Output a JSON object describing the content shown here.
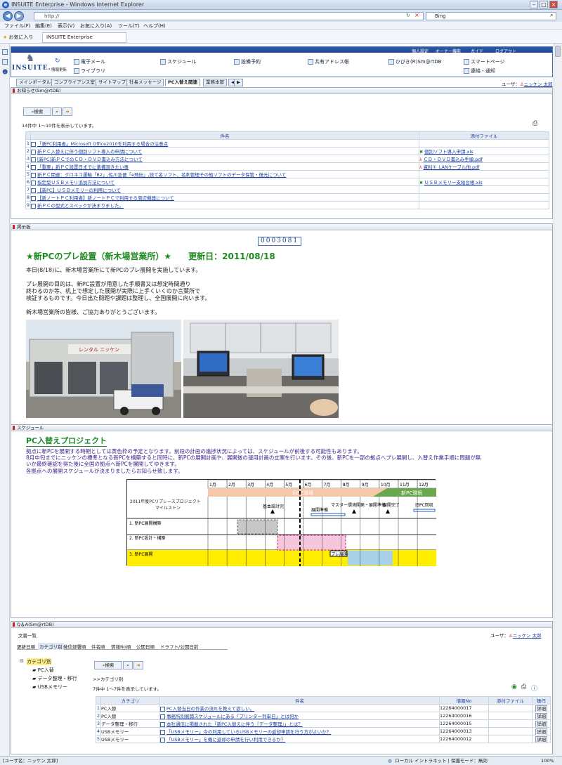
{
  "window": {
    "title": "INSUITE Enterprise - Windows Internet Explorer",
    "url": "http://",
    "search_engine": "Bing"
  },
  "menu": [
    "ファイル(F)",
    "編集(E)",
    "表示(V)",
    "お気に入り(A)",
    "ツール(T)",
    "ヘルプ(H)"
  ],
  "favorites": {
    "label": "お気に入り",
    "tab": "INSUITE Enterprise"
  },
  "header": {
    "brand": "INSUITE.",
    "refresh": "情報更新",
    "top_links": [
      "個人設定",
      "オーナー機能",
      "ガイド",
      "ログアウト"
    ],
    "links": [
      "電子メール",
      "スケジュール",
      "設備予約",
      "共有アドレス帳",
      "ひびき(R)Sm@rtDB",
      "スマートページ",
      "ライブラリ",
      "連絡・通知"
    ]
  },
  "tabs": [
    "メインポータル",
    "コンプライアンス室",
    "サイトマップ",
    "社長メッセージ",
    "PC入替え関連",
    "業務本部"
  ],
  "user_line": "ユーザ：",
  "user_name": "ニッケン 太郎",
  "news": {
    "title": "お知らせ(Sm@rtDB)",
    "search_btn": "検索",
    "count": "14件中 1〜10件を表示しています。",
    "col_subject": "件名",
    "col_file": "添付ファイル",
    "rows": [
      {
        "n": "1",
        "subject": "「新PC利用者」Microsoft Office2010を利用する場合の注意点",
        "file": ""
      },
      {
        "n": "2",
        "subject": "新ＰＣ入替えに伴う個別ソフト導入の申請について",
        "file": "個別ソフト導入申請.xls"
      },
      {
        "n": "3",
        "subject": "[新PC]新ＰＣでのＣＤ・ＤＶＤ書込み方法について",
        "file": "ＣＤ・ＤＶＤ書込み手順.pdf"
      },
      {
        "n": "4",
        "subject": "「重要」新ＰＣ設置日までに準備頂きたい事",
        "file": "資料①_LANケーブル他.pdf"
      },
      {
        "n": "5",
        "subject": "新ＰＣ関連：クロネコ運輸「B2」,佐川急便「e飛伝」,読て名ソフト、名刺管理その他ソフトのデータ保管・復元について",
        "file": ""
      },
      {
        "n": "6",
        "subject": "指定型ＵＳＢメモリ追加方法について",
        "file": "ＵＳＢメモリー支給台帳.xls"
      },
      {
        "n": "7",
        "subject": "【新PC】ＵＳＢメモリーの利用について",
        "file": ""
      },
      {
        "n": "8",
        "subject": "【新ノートＰＣ利用者】新ノートＰＣで利用する周辺機器について",
        "file": ""
      },
      {
        "n": "9",
        "subject": "新ＰＣの型式とスペックが決まりました。",
        "file": ""
      }
    ]
  },
  "announce": {
    "title": "掲示板",
    "counter": "0003081",
    "heading": "★新PCのプレ設置（新木場営業所）★　　更新日：2011/08/18",
    "lines": [
      "本日(8/18)に、新木場営業所にて新PCのプレ展開を実施しています。",
      "プレ展開の目的は、新PC設置が用意した手順書又は想定時間通り",
      "終わるのか等、机上で想定した展開が実際に上手くいくのか言葉所で",
      "検証するものです。今日出た問題や課題は整理し、全国展開に向います。",
      "新木場営業所の皆様、ご協力ありがとうございます。"
    ]
  },
  "schedule": {
    "panel_title": "スケジュール",
    "title": "PC入替えプロジェクト",
    "lines": [
      "拠点に新PCを展開する時期としては黄色枠の予定となります。前段の計画の進捗状況によっては、スケジュールが前後する可能性もあります。",
      "8月中旬までにニッケンの標準となる新PCを構築すると同時に、新PCの展開計画や、展開後の運用計画の立案を行います。その後、新PCを一部の拠点へプレ展開し、入替え作業手順に問題が無",
      "いか最終確認を得た後に全国の拠点へ新PCを展開してゆきます。",
      "各拠点への展開スケジュールが決まりましたらお知らせ致します。"
    ],
    "gantt": {
      "months": [
        "1月",
        "2月",
        "3月",
        "4月",
        "5月",
        "6月",
        "7月",
        "8月",
        "9月",
        "10月",
        "11月",
        "12月"
      ],
      "header_left": "2011年度PCリプレースプロジェクト\nマイルストン",
      "phase_old": "旧PC環境",
      "phase_new": "新PC環境",
      "milestones": [
        "基本設計完",
        "展開準備",
        "マスター環境開発・展開準備",
        "展開完了",
        "旧PC回収"
      ],
      "rows": [
        "1. 新PC展開構築",
        "2. 新PC設計・構築",
        "3. 新PC展開"
      ],
      "badge": "プレ展開"
    }
  },
  "qa": {
    "title": "Q＆A(Sm@rtDB)",
    "doc_list": "文書一覧",
    "user_label": "ユーザ：",
    "user_name": "ニッケン 太郎",
    "views": [
      "更新日順",
      "カテゴリ別",
      "発信部署順",
      "件名順",
      "情報No順",
      "公開日順",
      "ドラフト/公開日前"
    ],
    "tree_root": "カテゴリ別",
    "tree": [
      "PC入替",
      "データ整理・移行",
      "USBメモリー"
    ],
    "search_btn": "検索",
    "crumb": ">>カテゴリ別",
    "count": "7件中 1〜7件を表示しています。",
    "cols": [
      "カテゴリ",
      "件名",
      "情報No",
      "添付ファイル",
      "操作"
    ],
    "rows": [
      {
        "n": "1",
        "cat": "PC入替",
        "subject": "PC入替当日の作業の流れを教えて欲しい。",
        "no": "12264000017",
        "op": "詳細"
      },
      {
        "n": "2",
        "cat": "PC入替",
        "subject": "事務所別展開スケジュールにある「プリンター列単日」とは何か",
        "no": "12264000016",
        "op": "詳細"
      },
      {
        "n": "3",
        "cat": "データ整理・移行",
        "subject": "本社通信に掲載された「新PC入替えに伴う『データ整理』」とは？",
        "no": "12264000015",
        "op": "詳細"
      },
      {
        "n": "4",
        "cat": "USBメモリー",
        "subject": "「USBメモリー」今の利用しているUSBメモリーの返却申請を行う方がよいか？",
        "no": "12264000013",
        "op": "詳細"
      },
      {
        "n": "5",
        "cat": "USBメモリー",
        "subject": "「USBメモリー」を機に返却の申請を行い利用できるか？",
        "no": "12264000012",
        "op": "詳細"
      }
    ]
  },
  "statusbar": {
    "user": "[ユーザ名：ニッケン 太郎]",
    "zone": "ローカル イントラネット | 保護モード：無効",
    "zoom": "100%"
  },
  "colors": {
    "header_blue": "#1d4690",
    "link": "#1a3e9c",
    "title_green": "#1f8a1f",
    "gantt_yellow": "#ffee00",
    "gantt_blue": "#a9d2e8",
    "gantt_pink": "#f5c6dc",
    "gantt_green": "#6aa84f",
    "gantt_salmon": "#f7c7a9"
  }
}
